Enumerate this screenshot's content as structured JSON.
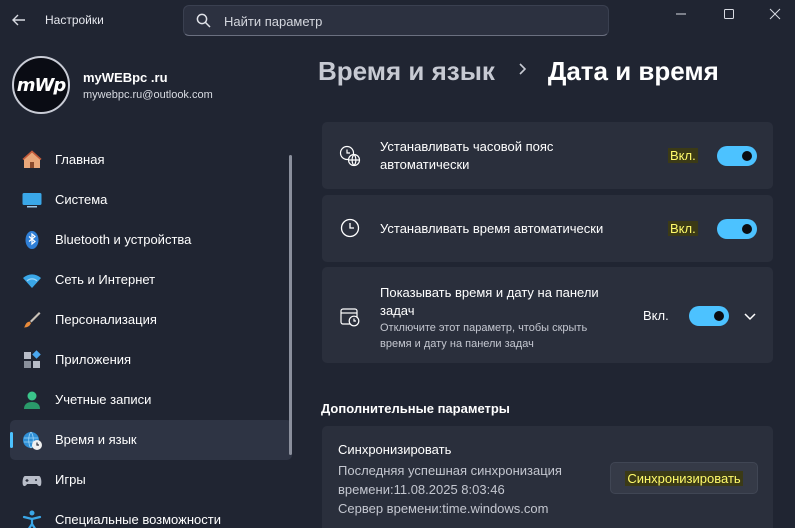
{
  "titlebar": {
    "app_title": "Настройки",
    "search_placeholder": "Найти параметр"
  },
  "profile": {
    "avatar_text": "mWp",
    "name": "myWEBpc .ru",
    "email": "mywebpc.ru@outlook.com"
  },
  "nav": {
    "items": [
      {
        "label": "Главная",
        "icon": "home-icon"
      },
      {
        "label": "Система",
        "icon": "monitor-icon"
      },
      {
        "label": "Bluetooth и устройства",
        "icon": "bluetooth-icon"
      },
      {
        "label": "Сеть и Интернет",
        "icon": "wifi-icon"
      },
      {
        "label": "Персонализация",
        "icon": "brush-icon"
      },
      {
        "label": "Приложения",
        "icon": "apps-icon"
      },
      {
        "label": "Учетные записи",
        "icon": "person-icon"
      },
      {
        "label": "Время и язык",
        "icon": "globe-clock-icon",
        "active": true
      },
      {
        "label": "Игры",
        "icon": "gamepad-icon"
      },
      {
        "label": "Специальные возможности",
        "icon": "accessibility-icon"
      }
    ]
  },
  "breadcrumb": {
    "parent": "Время и язык",
    "current": "Дата и время"
  },
  "settings": {
    "auto_timezone": {
      "title_line1": "Устанавливать часовой пояс",
      "title_line2": "автоматически",
      "state": "Вкл."
    },
    "auto_time": {
      "title": "Устанавливать время автоматически",
      "state": "Вкл."
    },
    "show_taskbar": {
      "title_line1": "Показывать время и дату на панели",
      "title_line2": "задач",
      "desc_line1": "Отключите этот параметр, чтобы скрыть",
      "desc_line2": "время и дату на панели задач",
      "state": "Вкл."
    }
  },
  "additional": {
    "section_title": "Дополнительные параметры",
    "sync_title": "Синхронизировать",
    "last_sync_line1": "Последняя успешная синхронизация",
    "last_sync_line2": "времени:11.08.2025 8:03:46",
    "server": "Сервер времени:time.windows.com",
    "sync_button": "Синхронизировать"
  },
  "colors": {
    "accent": "#4cc2ff",
    "background": "#202532",
    "card": "#2a2f3c",
    "highlight": "#fffb6b"
  }
}
